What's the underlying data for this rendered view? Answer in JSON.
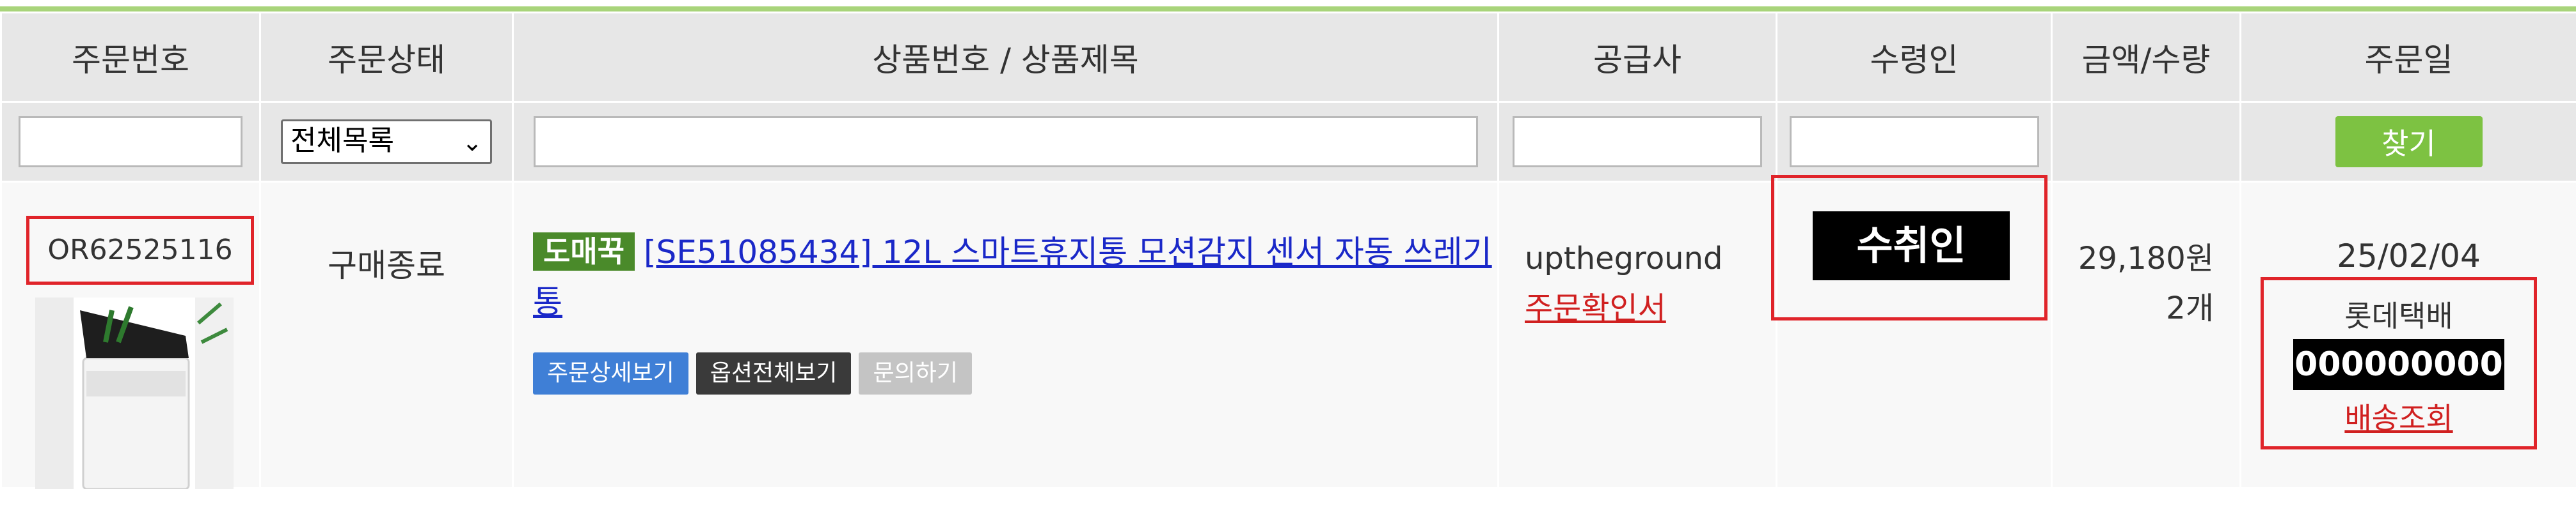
{
  "columns": [
    "주문번호",
    "주문상태",
    "상품번호 / 상품제목",
    "공급사",
    "수령인",
    "금액/수량",
    "주문일"
  ],
  "filters": {
    "status_selected": "전체목록",
    "find_button": "찾기"
  },
  "row": {
    "order_no": "OR62525116",
    "status": "구매종료",
    "badge": "도매꾹",
    "product_title": "[SE51085434] 12L 스마트휴지통 모션감지 센서 자동 쓰레기통",
    "buttons": {
      "order_detail": "주문상세보기",
      "option_all": "옵션전체보기",
      "inquiry": "문의하기"
    },
    "supplier": "uptheground",
    "order_confirm": "주문확인서",
    "recipient": "수취인",
    "amount": "29,180원",
    "quantity": "2개",
    "order_date": "25/02/04",
    "carrier": "롯데택배",
    "tracking_no": "000000000",
    "track_link": "배송조회"
  },
  "colors": {
    "header_bg": "#e7e7e7",
    "accent_green": "#7dc242",
    "highlight_red": "#e0242a",
    "link_blue": "#1a28c8"
  }
}
